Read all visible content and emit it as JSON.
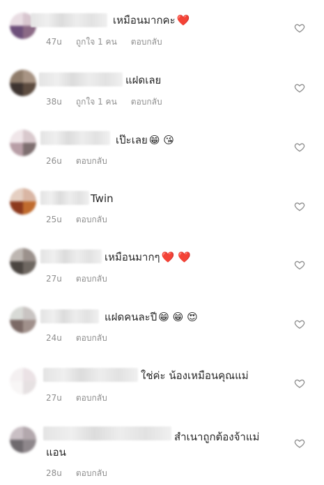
{
  "comments": [
    {
      "text": "เหมือนมากคะ",
      "emoji": "❤️",
      "time": "47u",
      "likes": "ถูกใจ 1 คน",
      "reply": "ตอบกลับ"
    },
    {
      "text": "แฝดเลย",
      "emoji": "",
      "time": "38u",
      "likes": "ถูกใจ 1 คน",
      "reply": "ตอบกลับ"
    },
    {
      "text": "เป๊ะเลย",
      "emoji": "😁 😘",
      "time": "26u",
      "likes": "",
      "reply": "ตอบกลับ"
    },
    {
      "text": "Twin",
      "emoji": "",
      "time": "25u",
      "likes": "",
      "reply": "ตอบกลับ"
    },
    {
      "text": "เหมือนมากๆ",
      "emoji": "❤️ ❤️",
      "time": "27u",
      "likes": "",
      "reply": "ตอบกลับ"
    },
    {
      "text": "แฝดคนละปี",
      "emoji": "😁 😁 😍",
      "time": "24u",
      "likes": "",
      "reply": "ตอบกลับ"
    },
    {
      "text": "ใช่ค่ะ น้องเหมือนคุณแม่",
      "emoji": "",
      "time": "27u",
      "likes": "",
      "reply": "ตอบกลับ"
    },
    {
      "text": "สำเนาถูกต้องจ้าแม่",
      "text2": "แอน",
      "emoji": "",
      "time": "28u",
      "likes": "",
      "reply": "ตอบกลับ"
    }
  ],
  "icons": {
    "like": "heart-outline-icon"
  },
  "colors": {
    "text": "#262626",
    "meta": "#8e8e8e",
    "heart_emoji": "#e0245e"
  }
}
